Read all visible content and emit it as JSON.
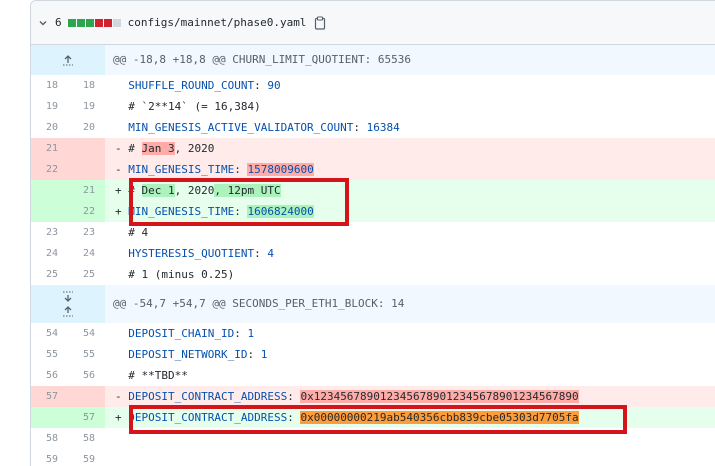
{
  "file": {
    "change_count": "6",
    "path": "configs/mainnet/phase0.yaml",
    "diffstat_colors": [
      "#2da44e",
      "#2da44e",
      "#2da44e",
      "#cf222e",
      "#cf222e",
      "#d0d7de"
    ]
  },
  "hunk1": {
    "header": "@@ -18,8 +18,8 @@ CHURN_LIMIT_QUOTIENT: 65536"
  },
  "hunk2": {
    "header": "@@ -54,7 +54,7 @@ SECONDS_PER_ETH1_BLOCK: 14"
  },
  "lines": {
    "l1": {
      "old": "18",
      "new": "18",
      "prefix": " ",
      "key": "SHUFFLE_ROUND_COUNT",
      "sep": ": ",
      "val": "90"
    },
    "l2": {
      "old": "19",
      "new": "19",
      "text": "  # `2**14` (= 16,384)"
    },
    "l3": {
      "old": "20",
      "new": "20",
      "prefix": " ",
      "key": "MIN_GENESIS_ACTIVE_VALIDATOR_COUNT",
      "sep": ": ",
      "val": "16384"
    },
    "l4": {
      "old": "21",
      "pre": "- # ",
      "hl": "Jan 3",
      "post": ", 2020"
    },
    "l5": {
      "old": "22",
      "pre": "- ",
      "key": "MIN_GENESIS_TIME",
      "sep": ": ",
      "hl": "1578009600"
    },
    "l6": {
      "new": "21",
      "pre": "+ # ",
      "hl": "Dec 1",
      "mid": ", 2020",
      "hl2": ", 12pm UTC"
    },
    "l7": {
      "new": "22",
      "pre": "+ ",
      "key": "MIN_GENESIS_TIME",
      "sep": ": ",
      "hl": "1606824000"
    },
    "l8": {
      "old": "23",
      "new": "23",
      "text": "  # 4"
    },
    "l9": {
      "old": "24",
      "new": "24",
      "prefix": " ",
      "key": "HYSTERESIS_QUOTIENT",
      "sep": ": ",
      "val": "4"
    },
    "l10": {
      "old": "25",
      "new": "25",
      "text": "  # 1 (minus 0.25)"
    },
    "l11": {
      "old": "54",
      "new": "54",
      "prefix": " ",
      "key": "DEPOSIT_CHAIN_ID",
      "sep": ": ",
      "val": "1"
    },
    "l12": {
      "old": "55",
      "new": "55",
      "prefix": " ",
      "key": "DEPOSIT_NETWORK_ID",
      "sep": ": ",
      "val": "1"
    },
    "l13": {
      "old": "56",
      "new": "56",
      "text": "  # **TBD**"
    },
    "l14": {
      "old": "57",
      "pre": "- ",
      "key": "DEPOSIT_CONTRACT_ADDRESS",
      "sep": ": ",
      "hl": "0x1234567890123456789012345678901234567890"
    },
    "l15": {
      "new": "57",
      "pre": "+ ",
      "key": "DEPOSIT_CONTRACT_ADDRESS",
      "sep": ": ",
      "hl": "0x00000000219ab540356cbb839cbe05303d7705fa"
    },
    "l16": {
      "old": "58",
      "new": "58",
      "text": ""
    },
    "l17": {
      "old": "59",
      "new": "59",
      "text": ""
    }
  }
}
